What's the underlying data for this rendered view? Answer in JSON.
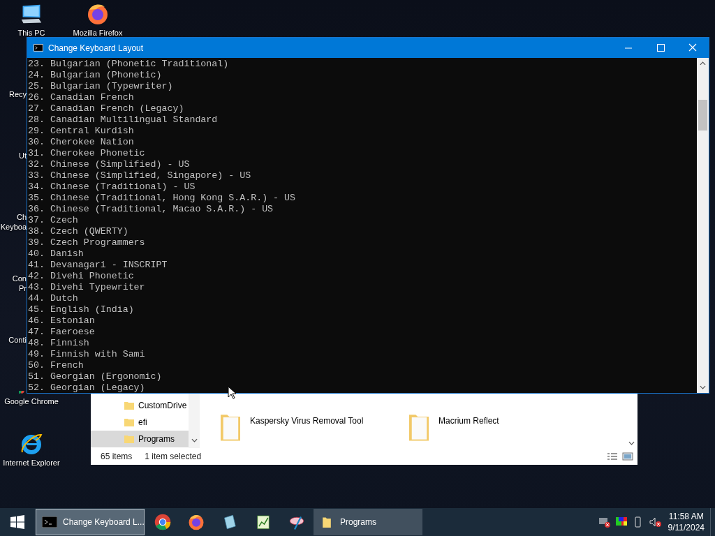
{
  "desktop_icons": [
    {
      "lines": [
        "This PC"
      ]
    },
    {
      "lines": [
        "Recy"
      ]
    },
    {
      "lines": [
        "Ut"
      ]
    },
    {
      "lines": [
        "Ch",
        "Keyboa"
      ]
    },
    {
      "lines": [
        "Con",
        "Pr"
      ]
    },
    {
      "lines": [
        "Conti"
      ]
    },
    {
      "lines": [
        "Google Chrome"
      ]
    },
    {
      "lines": [
        "Internet Explorer"
      ]
    },
    {
      "lines": [
        "Mozilla Firefox"
      ]
    }
  ],
  "explorer": {
    "nav_items": [
      {
        "label": "CustomDrive",
        "selected": false
      },
      {
        "label": "efi",
        "selected": false
      },
      {
        "label": "Programs",
        "selected": true
      }
    ],
    "files": [
      {
        "name": "Kaspersky Virus Removal Tool"
      },
      {
        "name": "Macrium Reflect"
      }
    ],
    "status_count": "65 items",
    "status_selection": "1 item selected"
  },
  "console": {
    "title": "Change Keyboard Layout",
    "lines": [
      "23. Bulgarian (Phonetic Traditional)",
      "24. Bulgarian (Phonetic)",
      "25. Bulgarian (Typewriter)",
      "26. Canadian French",
      "27. Canadian French (Legacy)",
      "28. Canadian Multilingual Standard",
      "29. Central Kurdish",
      "30. Cherokee Nation",
      "31. Cherokee Phonetic",
      "32. Chinese (Simplified) - US",
      "33. Chinese (Simplified, Singapore) - US",
      "34. Chinese (Traditional) - US",
      "35. Chinese (Traditional, Hong Kong S.A.R.) - US",
      "36. Chinese (Traditional, Macao S.A.R.) - US",
      "37. Czech",
      "38. Czech (QWERTY)",
      "39. Czech Programmers",
      "40. Danish",
      "41. Devanagari - INSCRIPT",
      "42. Divehi Phonetic",
      "43. Divehi Typewriter",
      "44. Dutch",
      "45. English (India)",
      "46. Estonian",
      "47. Faeroese",
      "48. Finnish",
      "49. Finnish with Sami",
      "50. French",
      "51. Georgian (Ergonomic)",
      "52. Georgian (Legacy)"
    ]
  },
  "taskbar": {
    "items": [
      {
        "kind": "window",
        "label": "Change Keyboard L...",
        "selected": true
      },
      {
        "kind": "pinned"
      },
      {
        "kind": "pinned"
      },
      {
        "kind": "pinned"
      },
      {
        "kind": "pinned"
      },
      {
        "kind": "pinned"
      },
      {
        "kind": "window",
        "label": "Programs",
        "selected": false
      }
    ],
    "time": "11:58 AM",
    "date": "9/11/2024"
  }
}
